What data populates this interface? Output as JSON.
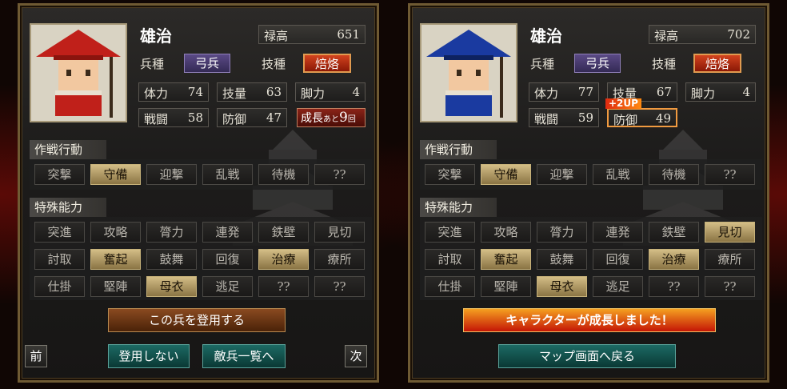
{
  "left": {
    "name": "雄治",
    "stipend_label": "禄高",
    "stipend_value": "651",
    "troop_label": "兵種",
    "troop_value": "弓兵",
    "skill_label": "技種",
    "skill_value": "焙烙",
    "stats": [
      {
        "label": "体力",
        "value": "74"
      },
      {
        "label": "技量",
        "value": "63"
      },
      {
        "label": "脚力",
        "value": "4"
      },
      {
        "label": "戦闘",
        "value": "58"
      },
      {
        "label": "防御",
        "value": "47"
      }
    ],
    "growth_prefix": "成長",
    "growth_small": "あと",
    "growth_num": "9",
    "growth_suffix": "回",
    "tactics_header": "作戦行動",
    "tactics": [
      "突撃",
      "守備",
      "迎撃",
      "乱戦",
      "待機",
      "??"
    ],
    "special_header": "特殊能力",
    "special": [
      "突進",
      "攻略",
      "膂力",
      "連発",
      "鉄壁",
      "見切",
      "討取",
      "奮起",
      "鼓舞",
      "回復",
      "治療",
      "療所",
      "仕掛",
      "堅陣",
      "母衣",
      "逃足",
      "??",
      "??"
    ],
    "recruit_button": "この兵を登用する",
    "prev_button": "前",
    "decline_button": "登用しない",
    "enemy_list_button": "敵兵一覧へ",
    "next_button": "次"
  },
  "right": {
    "name": "雄治",
    "stipend_label": "禄高",
    "stipend_value": "702",
    "troop_label": "兵種",
    "troop_value": "弓兵",
    "skill_label": "技種",
    "skill_value": "焙烙",
    "stats": [
      {
        "label": "体力",
        "value": "77"
      },
      {
        "label": "技量",
        "value": "67"
      },
      {
        "label": "脚力",
        "value": "4"
      },
      {
        "label": "戦闘",
        "value": "59"
      },
      {
        "label": "防御",
        "value": "49"
      }
    ],
    "up_badge": "+2UP",
    "tactics_header": "作戦行動",
    "tactics": [
      "突撃",
      "守備",
      "迎撃",
      "乱戦",
      "待機",
      "??"
    ],
    "special_header": "特殊能力",
    "special": [
      "突進",
      "攻略",
      "膂力",
      "連発",
      "鉄壁",
      "見切",
      "討取",
      "奮起",
      "鼓舞",
      "回復",
      "治療",
      "療所",
      "仕掛",
      "堅陣",
      "母衣",
      "逃足",
      "??",
      "??"
    ],
    "growth_banner": "キャラクターが成長しました！",
    "map_button": "マップ画面へ戻る"
  },
  "colors": {
    "active": "#d3bd86",
    "hat_left": "#c0201a",
    "hat_right": "#1a3aa0"
  }
}
